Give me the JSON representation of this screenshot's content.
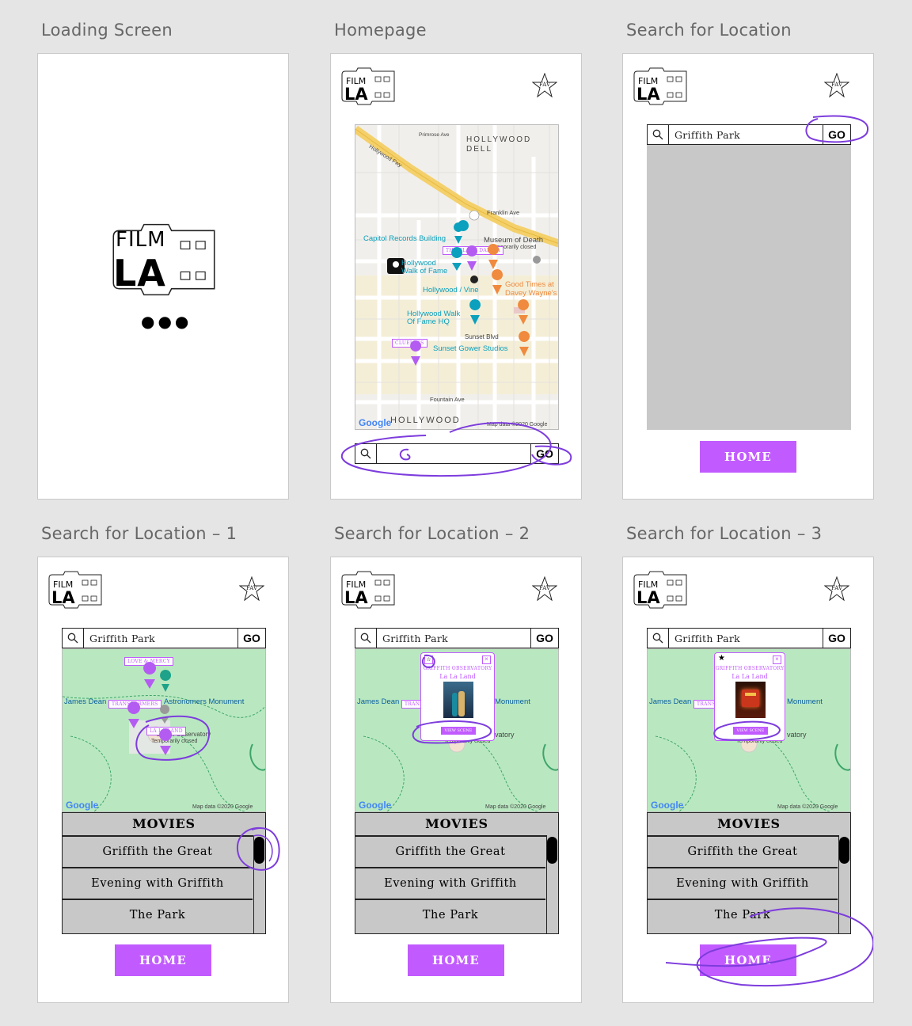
{
  "boards": [
    {
      "title": "Loading Screen"
    },
    {
      "title": "Homepage"
    },
    {
      "title": "Search for Location"
    },
    {
      "title": "Search for Location – 1"
    },
    {
      "title": "Search for Location – 2"
    },
    {
      "title": "Search for Location – 3"
    }
  ],
  "logo": {
    "line1": "FILM",
    "line2": "LA"
  },
  "fav_label": "FAV",
  "loading_dots": "●●●",
  "search": {
    "value": "Griffith Park",
    "go_label": "GO"
  },
  "home_label": "HOME",
  "movies": {
    "header": "MOVIES",
    "items": [
      "Griffith the Great",
      "Evening with Griffith",
      "The Park"
    ]
  },
  "homepage_map": {
    "places": {
      "hollywood_dell": "HOLLYWOOD\nDELL",
      "hollywood_fwy": "Hollywood Fwy",
      "franklin_ave": "Franklin Ave",
      "capitol_records": "Capitol Records Building",
      "museum_of_death": "Museum of Death",
      "temporarily_closed": "Temporarily closed",
      "walk_of_fame": "Hollywood\nWalk of Fame",
      "hollywood_vine": "Hollywood / Vine",
      "good_times": "Good Times at\nDavey Wayne's",
      "walk_of_fame_hq": "Hollywood Walk\nOf Fame HQ",
      "sunset_blvd": "Sunset Blvd",
      "sunset_gower": "Sunset Gower Studios",
      "fountain_ave": "Fountain Ave",
      "hollywood": "HOLLYWOOD",
      "google": "Google",
      "map_data": "Map data ©2020 Google"
    },
    "tags": {
      "black_dahlia": "THE BLACK DAHLIA",
      "clueless": "CLUELESS"
    }
  },
  "griffith_map": {
    "james_dean": "James Dean",
    "astronomers": "Astronomers Monument",
    "observatory": "Griffith Observatory",
    "temporarily_closed": "Temporarily closed",
    "google": "Google",
    "map_data": "Map data ©2020 Google",
    "tags": {
      "love_mercy": "LOVE & MERCY",
      "transformers": "TRANSFORMERS",
      "la_la_land": "LA LA LAND"
    }
  },
  "popup": {
    "title": "GRIFFITH OBSERVATORY",
    "movie": "La La Land",
    "view_scene": "VIEW SCENE",
    "close": "×"
  },
  "colors": {
    "accent": "#c15bff",
    "teal": "#0ba0bd",
    "orange": "#f08a3e",
    "park": "#b9e8c0",
    "annotation": "#7d3cdd"
  }
}
